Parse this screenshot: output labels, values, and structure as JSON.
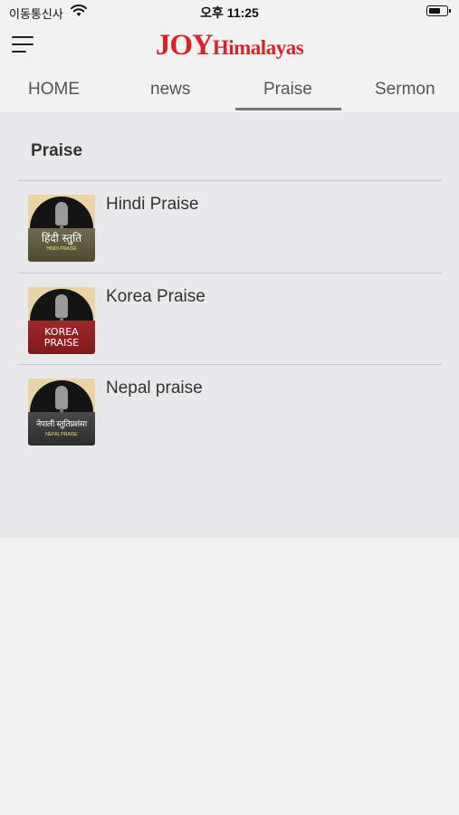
{
  "status_bar": {
    "carrier": "이동통신사",
    "time": "오후 11:25",
    "wifi_icon": "wifi-icon",
    "battery_icon": "battery-icon"
  },
  "header": {
    "menu_icon": "hamburger-menu-icon",
    "logo_joy": "JOY",
    "logo_himalayas": "Himalayas",
    "brand_color": "#d9232b"
  },
  "tabs": [
    {
      "label": "HOME",
      "active": false
    },
    {
      "label": "news",
      "active": false
    },
    {
      "label": "Praise",
      "active": true
    },
    {
      "label": "Sermon",
      "active": false
    }
  ],
  "section": {
    "title": "Praise",
    "items": [
      {
        "label": "Hindi Praise",
        "thumb_main": "हिंदी स्तुति",
        "thumb_sub": "HINDI PRAISE"
      },
      {
        "label": "Korea Praise",
        "thumb_main": "KOREA PRAISE",
        "thumb_sub": ""
      },
      {
        "label": "Nepal praise",
        "thumb_main": "नेपाली स्तुतिप्रशंसा",
        "thumb_sub": "NEPAL PRAISE"
      }
    ]
  }
}
